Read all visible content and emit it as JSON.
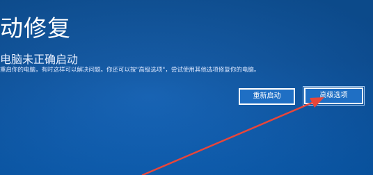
{
  "screen": {
    "title": "动修复",
    "subtitle": "电脑未正确启动",
    "message": "重启你的电脑，有时这样可以解决问题。你还可以按\"高级选项\"，尝试使用其他选项修复你的电脑。"
  },
  "buttons": {
    "restart_label": "重新启动",
    "advanced_label": "高级选项"
  },
  "annotation": {
    "arrow_color": "#e8463a"
  }
}
